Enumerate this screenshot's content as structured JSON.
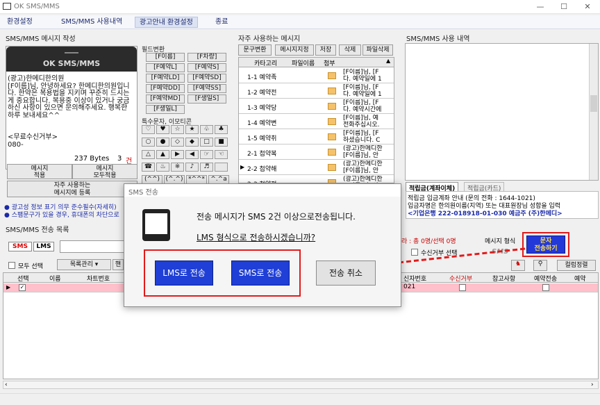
{
  "window": {
    "title": "OK SMS/MMS"
  },
  "menu": [
    "환경설정",
    "SMS/MMS 사용내역",
    "광고안내 환경설정",
    "종료"
  ],
  "compose": {
    "section_title": "SMS/MMS 메시지 작성",
    "phone_label": "OK SMS/MMS",
    "message": "(광고)한메디한의원\n[F이름]님, 안녕하세요? 한메디한의원입니다. 한약은 복용법을 지키며 꾸준히 드시는게 중요합니다. 복용중 이상이 있거나 궁금하신 사항이 있으면 문의해주세요. 행복한 하루 보내세요^^",
    "optout": "<무료수신거부>\n080-",
    "bytes": "237 Bytes",
    "count": "3",
    "count_unit": "건",
    "apply_btn": "메시지\n적용",
    "apply_all_btn": "메시지\n모두적용",
    "register_btn": "자주 사용하는\n메시지에 등록"
  },
  "fields": {
    "title": "필드변환",
    "buttons": [
      "[F이름]",
      "[F차량]",
      "[F예약L]",
      "[F예약S]",
      "[F예약LD]",
      "[F예약SD]",
      "[F예약DD]",
      "[F예약SS]",
      "[F예약MD]",
      "[F생일S]",
      "[F생일L]"
    ],
    "special_title": "특수문자, 이모티콘",
    "symbols": [
      "♡",
      "♥",
      "☆",
      "★",
      "♧",
      "♣",
      "○",
      "●",
      "◇",
      "◆",
      "□",
      "■",
      "△",
      "▲",
      "▶",
      "◀",
      "☞",
      "☜",
      "☎",
      "♨",
      "※",
      "♪",
      "♬",
      "",
      "(^^)",
      "(^.^)",
      "*^^*",
      "^.^a"
    ]
  },
  "notice": [
    "● 광고성 정보 표기 의무 준수필수(자세히)",
    "● 스팸문구가 있을 경우, 휴대폰의 차단으로"
  ],
  "frequent": {
    "title": "자주 사용하는 메시지",
    "tools": [
      "문구변환",
      "메시지지정",
      "저장",
      "삭제",
      "파일삭제"
    ],
    "headers": [
      "카타고리",
      "파일이름",
      "첨부"
    ],
    "rows": [
      {
        "name": "1-1 예약족",
        "text": "[F이름]님, [F\n다. 예약일에 1"
      },
      {
        "name": "1-2 예약전",
        "text": "[F이름]님, [F\n다. 예약일에 1"
      },
      {
        "name": "1-3 예약당",
        "text": "[F이름]님, [F\n다. 예약시간에"
      },
      {
        "name": "1-4 예약변",
        "text": "[F이름]님, 예\n전화주십시오."
      },
      {
        "name": "1-5 예약취",
        "text": "[F이름]님, [F\n하셨습니다. C"
      },
      {
        "name": "2-1 첩약복",
        "text": "(광고)한메디한\n[F이름]님, 안"
      },
      {
        "name": "2-2 첩약해",
        "text": "(광고)한메디한\n[F이름]님, 안"
      },
      {
        "name": "2-3 첩약전",
        "text": "(광고)한메디한\n[F이름]님, 안"
      }
    ]
  },
  "history": {
    "title": "SMS/MMS 사용 내역",
    "tabs": [
      "적립금(계좌이체)",
      "적립금(카드)"
    ],
    "info1": "적립금 입금계좌 안내 (문의 전화 : 1644-1021)",
    "info2": "입금자명은 한의원이름(지역) 또는 대표원장님 성함을 입력",
    "info3": "<기업은행 222-018918-01-030 예금주 (주)한메디>"
  },
  "send_list": {
    "title": "SMS/MMS 전송 목록",
    "sms_tag": "SMS",
    "lms_tag": "LMS",
    "select_all": "모두 선택",
    "manage": "목록관리",
    "manage2": "핸",
    "summary": "라 : 총 0명/선택 0명",
    "msg_format_label": "메시지 형식",
    "msg_format_value": "SMS",
    "optout_select": "수신거부 선택",
    "send_btn": "문자\n전송하기",
    "sort_btn": "컬럼정렬",
    "headers": [
      "선택",
      "이름",
      "차트번호",
      "신자번호",
      "수신거부",
      "참고사항",
      "예약전송",
      "예약"
    ],
    "row_phone": "021"
  },
  "dialog": {
    "title": "SMS 전송",
    "line1": "전송 메시지가 SMS 2건 이상으로전송됩니다.",
    "line2": "LMS 형식으로 전송하시겠습니까?",
    "lms_btn": "LMS로 전송",
    "sms_btn": "SMS로 전송",
    "cancel_btn": "전송 취소"
  },
  "colors": {
    "accent": "#1f3fd6",
    "highlight": "#e21a1a",
    "row_pink": "#ffc0cb"
  }
}
